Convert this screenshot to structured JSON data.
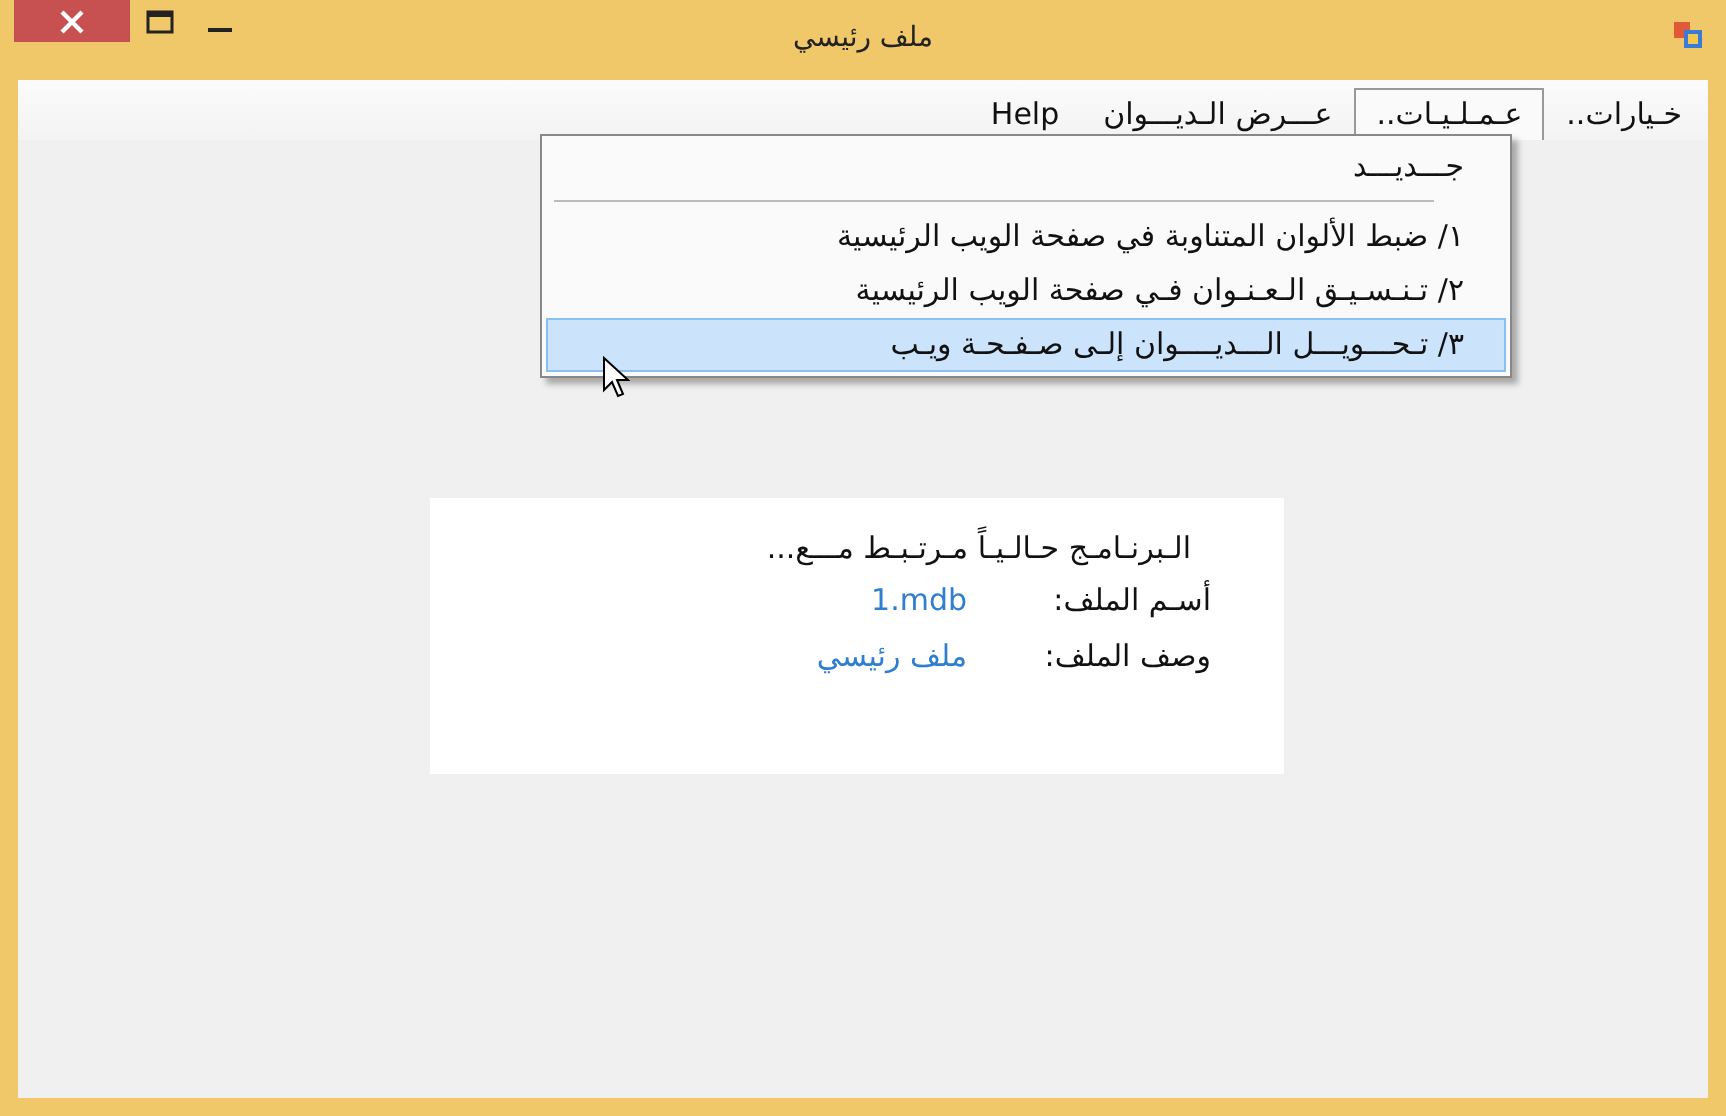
{
  "window": {
    "title": "ملف رئيسي"
  },
  "menu": [
    {
      "label": "خـيارات..",
      "selected": false
    },
    {
      "label": "عـمـلـيـات..",
      "selected": true
    },
    {
      "label": "عـــرض الـديـــوان",
      "selected": false
    },
    {
      "label": "Help",
      "selected": false
    }
  ],
  "dropdown": [
    {
      "kind": "item",
      "label": "جـــديـــد",
      "selected": false
    },
    {
      "kind": "separator"
    },
    {
      "kind": "item",
      "label": "١/ ضبط الألوان المتناوبة في صفحة الويب الرئيسية",
      "selected": false
    },
    {
      "kind": "item",
      "label": "٢/ تـنـسـيـق الـعـنـوان فـي صفحة الويب الرئيسية",
      "selected": false
    },
    {
      "kind": "item",
      "label": "٣/ تـحـــويـــل الـــديــــوان إلـى صـفـحـة ويـب",
      "selected": true
    }
  ],
  "status": {
    "heading": "الـبرنـامـج حـالـيـاً مـرتـبـط مـــع...",
    "fields": [
      {
        "label": "أسـم الملف:",
        "value": "1.mdb"
      },
      {
        "label": "وصف الملف:",
        "value": "ملف رئيسي"
      }
    ]
  }
}
